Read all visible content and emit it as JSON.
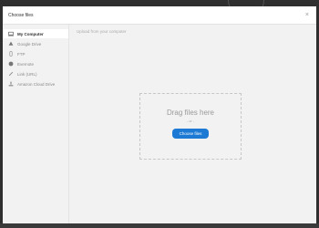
{
  "dialog": {
    "title": "Choose files",
    "close_label": "×"
  },
  "sidebar": {
    "items": [
      {
        "label": "My Computer",
        "icon": "computer-icon",
        "active": true
      },
      {
        "label": "Google Drive",
        "icon": "google-drive-icon",
        "active": false
      },
      {
        "label": "FTP",
        "icon": "ftp-icon",
        "active": false
      },
      {
        "label": "Evernote",
        "icon": "evernote-icon",
        "active": false
      },
      {
        "label": "Link (URL)",
        "icon": "link-icon",
        "active": false
      },
      {
        "label": "Amazon Cloud Drive",
        "icon": "amazon-cloud-drive-icon",
        "active": false
      }
    ]
  },
  "main": {
    "subtitle": "Upload from your computer",
    "drop_text": "Drag files here",
    "or_text": "- or -",
    "choose_button": "Choose files"
  },
  "colors": {
    "accent": "#1d7ad4",
    "panel": "#f2f2f2",
    "backdrop": "#2f2f2f"
  }
}
